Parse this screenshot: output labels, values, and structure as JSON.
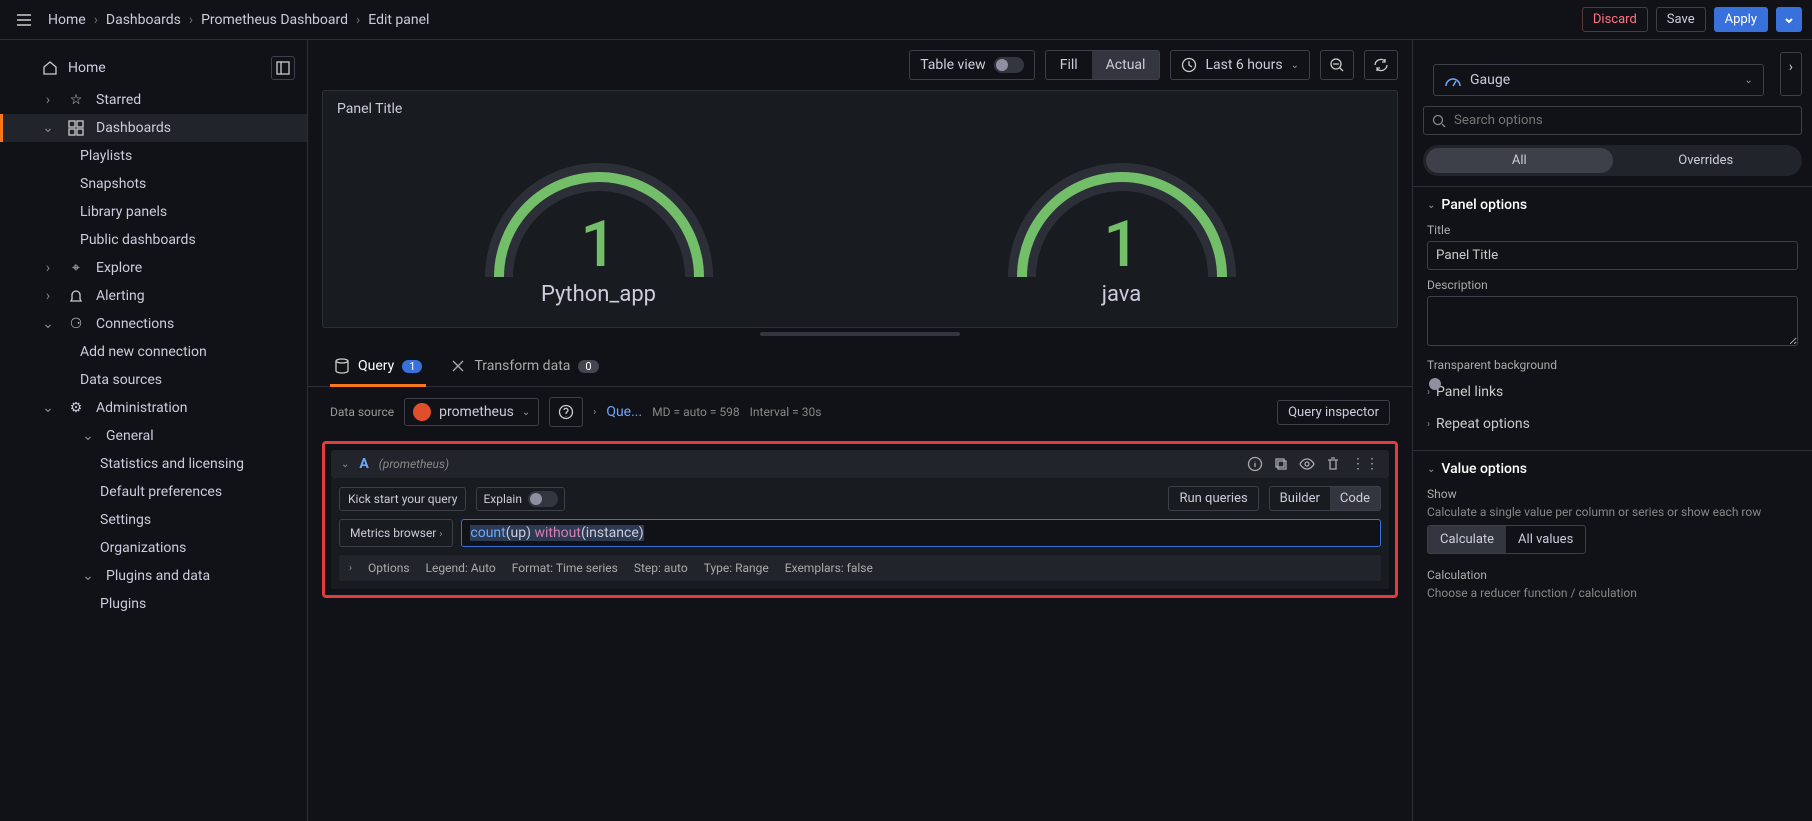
{
  "breadcrumb": [
    "Home",
    "Dashboards",
    "Prometheus Dashboard",
    "Edit panel"
  ],
  "topbar": {
    "discard": "Discard",
    "save": "Save",
    "apply": "Apply"
  },
  "sidebar": {
    "home": "Home",
    "starred": "Starred",
    "dashboards": "Dashboards",
    "playlists": "Playlists",
    "snapshots": "Snapshots",
    "library": "Library panels",
    "public": "Public dashboards",
    "explore": "Explore",
    "alerting": "Alerting",
    "connections": "Connections",
    "addconn": "Add new connection",
    "datasources": "Data sources",
    "admin": "Administration",
    "general": "General",
    "stats": "Statistics and licensing",
    "defaults": "Default preferences",
    "settings": "Settings",
    "orgs": "Organizations",
    "plugdata": "Plugins and data",
    "plugins": "Plugins"
  },
  "toolbar": {
    "tableview": "Table view",
    "fill": "Fill",
    "actual": "Actual",
    "timerange": "Last 6 hours"
  },
  "viz": {
    "type": "Gauge"
  },
  "panel": {
    "title": "Panel Title",
    "gauges": [
      {
        "value": "1",
        "label": "Python_app"
      },
      {
        "value": "1",
        "label": "java"
      }
    ]
  },
  "tabs": {
    "query": "Query",
    "query_count": "1",
    "transform": "Transform data",
    "transform_count": "0"
  },
  "qc": {
    "ds_label": "Data source",
    "ds_name": "prometheus",
    "que": "Que...",
    "md": "MD = auto = 598",
    "interval": "Interval = 30s",
    "inspector": "Query inspector"
  },
  "qr": {
    "letter": "A",
    "ds": "(prometheus)",
    "kick": "Kick start your query",
    "explain": "Explain",
    "run": "Run queries",
    "builder": "Builder",
    "code": "Code",
    "metrics_browser": "Metrics browser",
    "expr_fn": "count",
    "expr_arg": "(up) ",
    "expr_kw": "without",
    "expr_inst": "(instance)",
    "options": "Options",
    "legend": "Legend: Auto",
    "format": "Format: Time series",
    "step": "Step: auto",
    "type": "Type: Range",
    "exemplars": "Exemplars: false"
  },
  "rp": {
    "search_ph": "Search options",
    "all": "All",
    "overrides": "Overrides",
    "panel_options": "Panel options",
    "title_label": "Title",
    "title_value": "Panel Title",
    "desc_label": "Description",
    "transparent": "Transparent background",
    "panel_links": "Panel links",
    "repeat": "Repeat options",
    "value_options": "Value options",
    "show": "Show",
    "show_desc": "Calculate a single value per column or series or show each row",
    "calculate": "Calculate",
    "all_values": "All values",
    "calculation": "Calculation",
    "calc_desc": "Choose a reducer function / calculation"
  }
}
